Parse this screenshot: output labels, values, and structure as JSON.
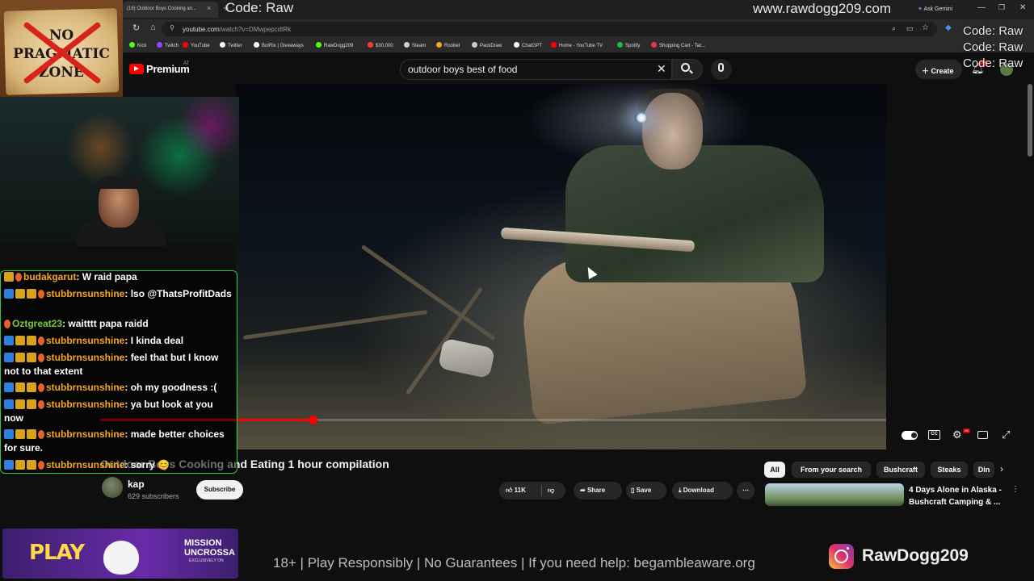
{
  "browser": {
    "tab_title": "(16) Outdoor Boys Cooking an...",
    "tab_close": "×",
    "new_tab": "+",
    "ask_gemini": "Ask Gemini",
    "url_host": "youtube.com",
    "url_path": "/watch?v=DMwpepcdtRk",
    "window_min": "—",
    "window_max": "❐",
    "window_close": "✕"
  },
  "bookmarks": [
    {
      "label": "Kick",
      "color": "#53fc18"
    },
    {
      "label": "Twitch",
      "color": "#9146ff"
    },
    {
      "label": "YouTube",
      "color": "#ff0000"
    },
    {
      "label": "Twitter",
      "color": "#ffffff"
    },
    {
      "label": "BotRix | Giveaways",
      "color": "#ffffff"
    },
    {
      "label": "RawDogg209",
      "color": "#53fc18"
    },
    {
      "label": "$30,000",
      "color": "#ff3b30"
    },
    {
      "label": "Steam",
      "color": "#c7d5e0"
    },
    {
      "label": "Roobet",
      "color": "#f5a623"
    },
    {
      "label": "PackDraw",
      "color": "#cccccc"
    },
    {
      "label": "ChatGPT",
      "color": "#ffffff"
    },
    {
      "label": "Home - YouTube TV",
      "color": "#ff0000"
    },
    {
      "label": "Spotify",
      "color": "#1db954"
    },
    {
      "label": "Shopping Cart - Tac...",
      "color": "#e63946"
    }
  ],
  "overlay": {
    "code_raw": "Code: Raw",
    "code_raw_stack": [
      "Code: Raw",
      "Code: Raw",
      "Code: Raw"
    ],
    "watermark_url": "www.rawdogg209.com",
    "sign_text": [
      "NO",
      "PRAGMATIC",
      "ZONE"
    ],
    "disclaimer": "18+ | Play Responsibly | No Guarantees | If you need help: begambleaware.org",
    "instagram_handle": "RawDogg209",
    "promo": {
      "play": "PLAY",
      "mission": [
        "MISSION",
        "UNCROSSA"
      ],
      "exclusive": "EXCLUSIVELY ON"
    }
  },
  "chat": [
    {
      "user": "budakgarut",
      "message": "W raid papa",
      "user_color": "orange"
    },
    {
      "user": "stubbrnsunshine",
      "message": "lso @ThatsProfitDads",
      "user_color": "orange"
    },
    {
      "user": "Oztgreat23",
      "message": "waitttt papa raidd",
      "user_color": "green"
    },
    {
      "user": "stubbrnsunshine",
      "message": "I kinda deal",
      "user_color": "orange"
    },
    {
      "user": "stubbrnsunshine",
      "message": "feel that but I know not to that extent",
      "user_color": "orange"
    },
    {
      "user": "stubbrnsunshine",
      "message": "oh my goodness :(",
      "user_color": "orange"
    },
    {
      "user": "stubbrnsunshine",
      "message": "ya but look at you now",
      "user_color": "orange"
    },
    {
      "user": "stubbrnsunshine",
      "message": "made better choices for sure.",
      "user_color": "orange"
    },
    {
      "user": "stubbrnsunshine",
      "message": "sorry 😊",
      "user_color": "orange"
    }
  ],
  "youtube": {
    "brand": "Premium",
    "region": "AT",
    "search_query": "outdoor boys best of food",
    "create_label": "Create",
    "notifications_count": "9+",
    "video": {
      "progress": 0.27,
      "title": "Outdoor Boys Cooking and Eating 1 hour compilation",
      "channel_name": "kap",
      "channel_subs": "629 subscribers",
      "subscribe_label": "Subscribe",
      "likes": "11K",
      "share_label": "Share",
      "save_label": "Save",
      "download_label": "Download",
      "cc_label": "CC",
      "hd_label": "HD"
    },
    "chips": [
      "All",
      "From your search",
      "Bushcraft",
      "Steaks",
      "Din"
    ],
    "recommendation": {
      "title": "4 Days Alone in Alaska - Bushcraft Camping & ..."
    }
  }
}
